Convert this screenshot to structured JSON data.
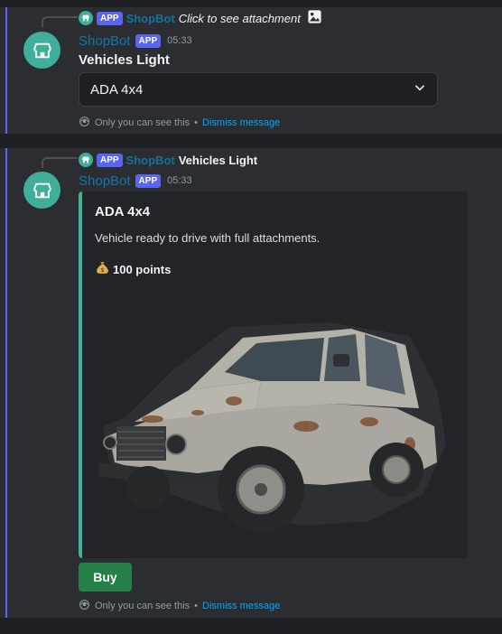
{
  "message1": {
    "reply": {
      "app_tag": "APP",
      "name": "ShopBot",
      "text": "Click to see attachment"
    },
    "author": {
      "name": "ShopBot",
      "app_tag": "APP",
      "time": "05:33"
    },
    "title": "Vehicles Light",
    "select": {
      "value": "ADA 4x4"
    },
    "ephemeral": {
      "text": "Only you can see this",
      "separator": "•",
      "dismiss": "Dismiss message"
    }
  },
  "message2": {
    "reply": {
      "app_tag": "APP",
      "name": "ShopBot",
      "text": "Vehicles Light"
    },
    "author": {
      "name": "ShopBot",
      "app_tag": "APP",
      "time": "05:33"
    },
    "embed": {
      "title": "ADA 4x4",
      "description": "Vehicle ready to drive with full attachments.",
      "price": "100 points",
      "price_icon": "money-bag-icon",
      "accent_color": "#3fb39a"
    },
    "button": {
      "label": "Buy"
    },
    "ephemeral": {
      "text": "Only you can see this",
      "separator": "•",
      "dismiss": "Dismiss message"
    }
  },
  "colors": {
    "app_tag": "#5865f2",
    "button": "#248046",
    "avatar": "#3fae9a",
    "link": "#00a8fc"
  }
}
